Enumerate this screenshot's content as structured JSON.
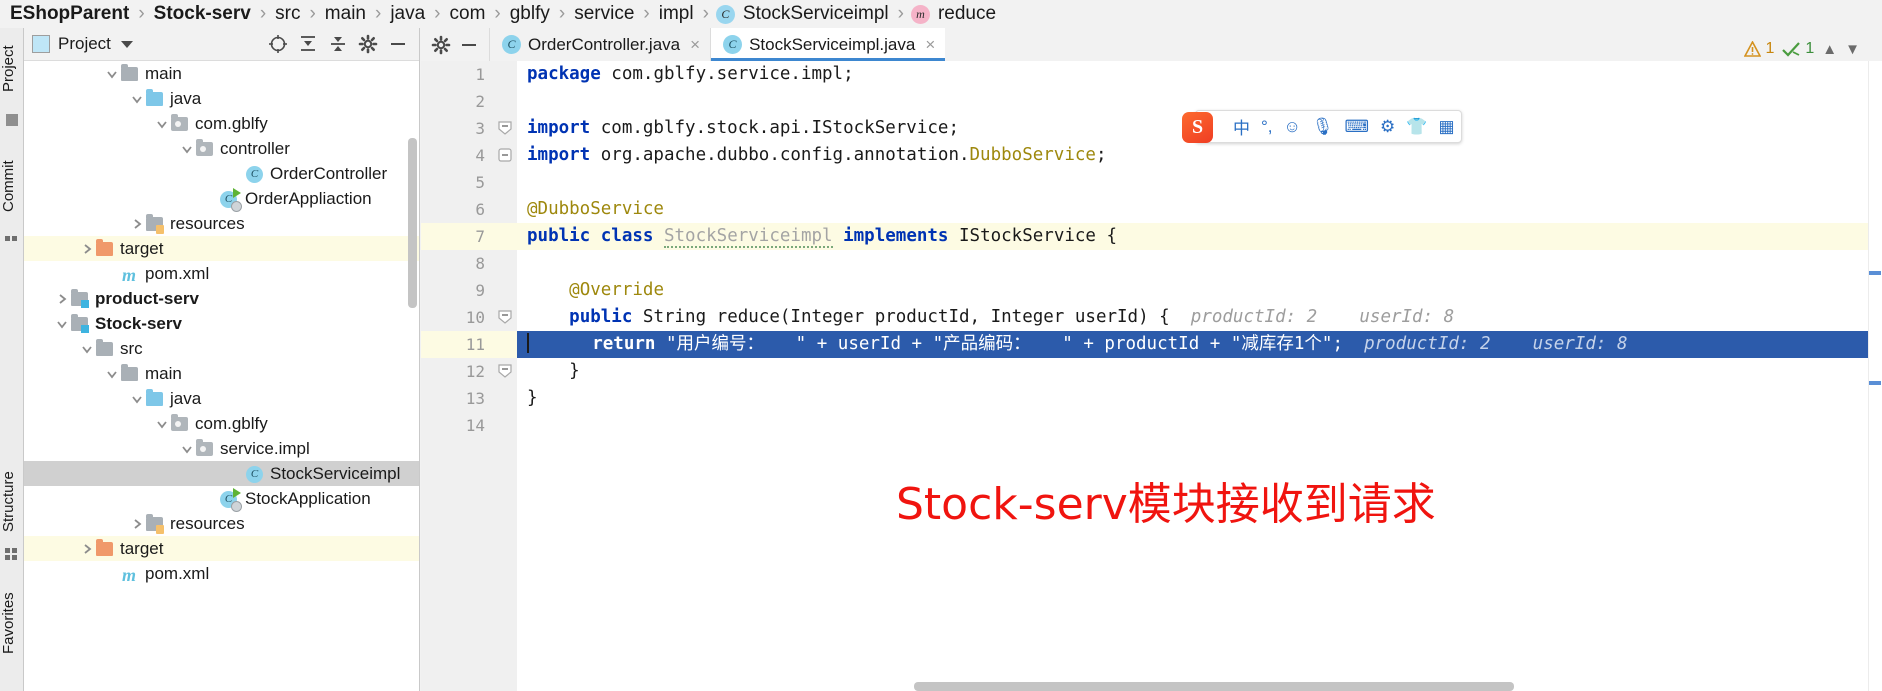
{
  "breadcrumb": {
    "items": [
      {
        "label": "EShopParent",
        "bold": true,
        "icon": null
      },
      {
        "label": "Stock-serv",
        "bold": true,
        "icon": null
      },
      {
        "label": "src",
        "bold": false,
        "icon": null
      },
      {
        "label": "main",
        "bold": false,
        "icon": null
      },
      {
        "label": "java",
        "bold": false,
        "icon": null
      },
      {
        "label": "com",
        "bold": false,
        "icon": null
      },
      {
        "label": "gblfy",
        "bold": false,
        "icon": null
      },
      {
        "label": "service",
        "bold": false,
        "icon": null
      },
      {
        "label": "impl",
        "bold": false,
        "icon": null
      },
      {
        "label": "StockServiceimpl",
        "bold": false,
        "icon": "class-icon",
        "glyph": "C"
      },
      {
        "label": "reduce",
        "bold": false,
        "icon": "method-icon",
        "glyph": "m"
      }
    ],
    "separator": "›"
  },
  "left_strip": {
    "labels": [
      "Project",
      "Commit",
      "Structure",
      "Favorites"
    ]
  },
  "project_panel": {
    "title": "Project",
    "toolbar": [
      {
        "name": "locate-icon",
        "tooltip": "Select Opened File"
      },
      {
        "name": "collapse-all-icon",
        "tooltip": "Collapse All"
      },
      {
        "name": "expand-all-icon",
        "tooltip": "Expand All"
      },
      {
        "name": "gear-icon",
        "tooltip": "Settings"
      },
      {
        "name": "hide-icon",
        "tooltip": "Hide"
      }
    ],
    "tree": [
      {
        "label": "main",
        "indent": 4,
        "arrow": "down",
        "icon": "folder-gray",
        "bold": false,
        "state": "normal"
      },
      {
        "label": "java",
        "indent": 5,
        "arrow": "down",
        "icon": "folder-blue",
        "bold": false,
        "state": "normal"
      },
      {
        "label": "com.gblfy",
        "indent": 6,
        "arrow": "down",
        "icon": "package",
        "bold": false,
        "state": "normal"
      },
      {
        "label": "controller",
        "indent": 7,
        "arrow": "down",
        "icon": "package",
        "bold": false,
        "state": "normal"
      },
      {
        "label": "OrderController",
        "indent": 9,
        "arrow": "none",
        "icon": "class",
        "bold": false,
        "state": "normal"
      },
      {
        "label": "OrderAppliaction",
        "indent": 8,
        "arrow": "none",
        "icon": "runnable-class",
        "bold": false,
        "state": "normal"
      },
      {
        "label": "resources",
        "indent": 5,
        "arrow": "right",
        "icon": "folder-res",
        "bold": false,
        "state": "normal"
      },
      {
        "label": "target",
        "indent": 3,
        "arrow": "right",
        "icon": "folder-orange",
        "bold": false,
        "state": "highlight"
      },
      {
        "label": "pom.xml",
        "indent": 4,
        "arrow": "none",
        "icon": "maven",
        "bold": false,
        "state": "normal"
      },
      {
        "label": "product-serv",
        "indent": 2,
        "arrow": "right",
        "icon": "folder-module",
        "bold": true,
        "state": "normal"
      },
      {
        "label": "Stock-serv",
        "indent": 2,
        "arrow": "down",
        "icon": "folder-module",
        "bold": true,
        "state": "normal"
      },
      {
        "label": "src",
        "indent": 3,
        "arrow": "down",
        "icon": "folder-gray",
        "bold": false,
        "state": "normal"
      },
      {
        "label": "main",
        "indent": 4,
        "arrow": "down",
        "icon": "folder-gray",
        "bold": false,
        "state": "normal"
      },
      {
        "label": "java",
        "indent": 5,
        "arrow": "down",
        "icon": "folder-blue",
        "bold": false,
        "state": "normal"
      },
      {
        "label": "com.gblfy",
        "indent": 6,
        "arrow": "down",
        "icon": "package",
        "bold": false,
        "state": "normal"
      },
      {
        "label": "service.impl",
        "indent": 7,
        "arrow": "down",
        "icon": "package",
        "bold": false,
        "state": "normal"
      },
      {
        "label": "StockServiceimpl",
        "indent": 9,
        "arrow": "none",
        "icon": "class",
        "bold": false,
        "state": "selected"
      },
      {
        "label": "StockApplication",
        "indent": 8,
        "arrow": "none",
        "icon": "runnable-class",
        "bold": false,
        "state": "normal"
      },
      {
        "label": "resources",
        "indent": 5,
        "arrow": "right",
        "icon": "folder-res",
        "bold": false,
        "state": "normal"
      },
      {
        "label": "target",
        "indent": 3,
        "arrow": "right",
        "icon": "folder-orange",
        "bold": false,
        "state": "highlight"
      },
      {
        "label": "pom.xml",
        "indent": 4,
        "arrow": "none",
        "icon": "maven",
        "bold": false,
        "state": "normal"
      }
    ]
  },
  "editor": {
    "tabs": [
      {
        "label": "OrderController.java",
        "active": false,
        "icon": "class-icon",
        "glyph": "C",
        "close": "×"
      },
      {
        "label": "StockServiceimpl.java",
        "active": true,
        "icon": "class-icon",
        "glyph": "C",
        "close": "×"
      }
    ],
    "line_numbers": [
      "1",
      "2",
      "3",
      "4",
      "5",
      "6",
      "7",
      "8",
      "9",
      "10",
      "11",
      "12",
      "13",
      "14"
    ],
    "inspection": {
      "warning_count": "1",
      "ok_count": "1",
      "warning_icon": "warning-triangle-icon",
      "ok_icon": "inspection-check-icon",
      "up_chevron": "chevron-up-icon",
      "down_chevron": "chevron-down-icon"
    },
    "code": {
      "l1_kw": "package",
      "l1_rest": " com.gblfy.service.impl;",
      "l3_kw": "import",
      "l3_rest": " com.gblfy.stock.api.IStockService;",
      "l4_kw": "import",
      "l4_mid": " org.apache.dubbo.config.annotation.",
      "l4_cls": "DubboService",
      "l4_end": ";",
      "l6_ann": "@DubboService",
      "l7_kw1": "public class",
      "l7_name": "StockServiceimpl",
      "l7_kw2": "implements",
      "l7_iface": "IStockService {",
      "l9_ann": "@Override",
      "l10_kw": "public",
      "l10_rest": " String reduce(Integer productId, Integer userId) {",
      "l10_hint1": "productId: 2",
      "l10_hint2": "userId: 8",
      "l11_kw": "return",
      "l11_s1": "\"用户编号：   \"",
      "l11_p1": " + userId + ",
      "l11_s2": "\"产品编码：   \"",
      "l11_p2": " + productId + ",
      "l11_s3": "\"减库存1个\"",
      "l11_end": ";",
      "l11_hint1": "productId: 2",
      "l11_hint2": "userId: 8",
      "l12": "}",
      "l13": "}"
    },
    "gutter_icons": {
      "line10": [
        "implemented-method-icon",
        "override-arrow-icon",
        "fold-collapse-icon"
      ],
      "line11": [
        "breakpoint-icon"
      ]
    }
  },
  "ime_toolbar": {
    "logo": "S",
    "items": [
      {
        "name": "chinese-mode-icon",
        "glyph": "中"
      },
      {
        "name": "punctuation-icon",
        "glyph": "°,"
      },
      {
        "name": "emoji-icon",
        "glyph": "☺"
      },
      {
        "name": "voice-input-icon",
        "glyph": "🎙"
      },
      {
        "name": "keyboard-icon",
        "glyph": "⌨"
      },
      {
        "name": "toolbox-icon",
        "glyph": "⚙"
      },
      {
        "name": "skin-icon",
        "glyph": "👕"
      },
      {
        "name": "apps-icon",
        "glyph": "▦"
      }
    ]
  },
  "annotation": {
    "red_note": "Stock-serv模块接收到请求",
    "red_color": "#f0140f"
  },
  "colors": {
    "accent": "#3d87d0",
    "selection": "#2c5bab",
    "keyword": "#0033b3",
    "annotation": "#9e880d",
    "string": "#067d17",
    "highlight_row": "#fdfbe3"
  }
}
